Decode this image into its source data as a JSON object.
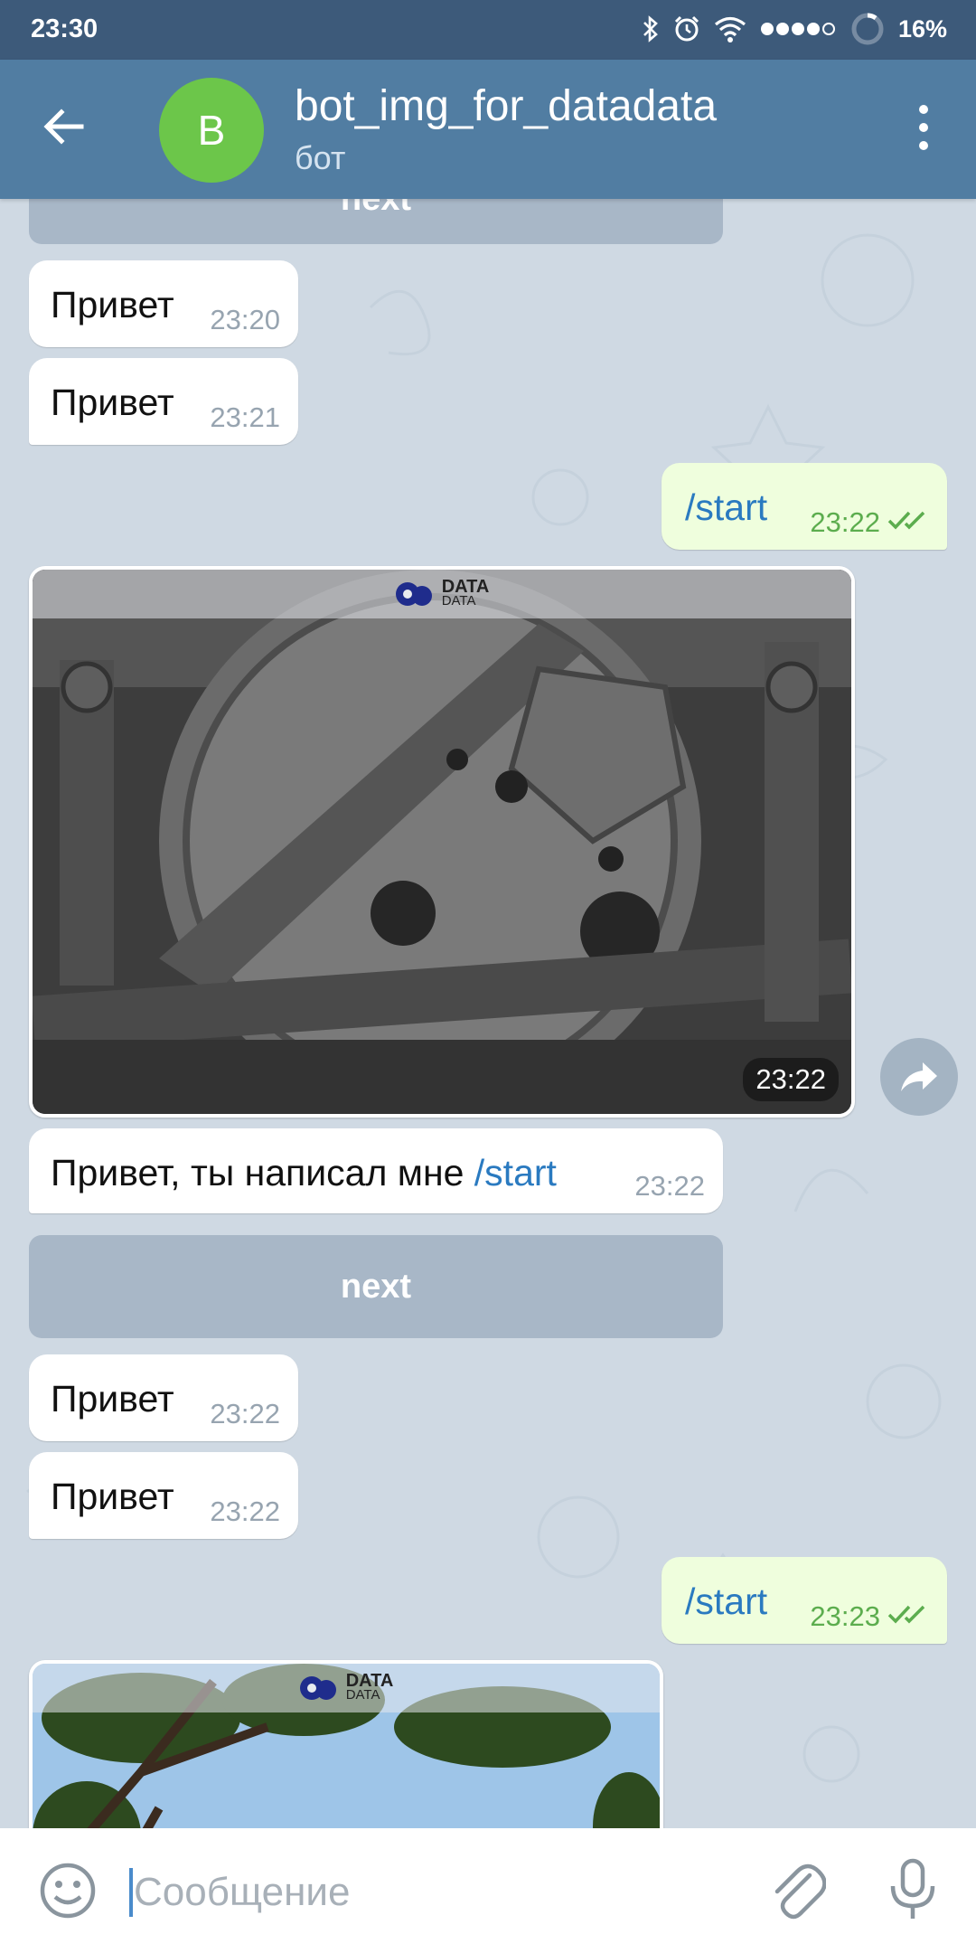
{
  "status_bar": {
    "time": "23:30",
    "battery": "16%"
  },
  "header": {
    "avatar_letter": "B",
    "title": "bot_img_for_datadata",
    "subtitle": "бот"
  },
  "messages": {
    "next_top": "next",
    "m1": {
      "text": "Привет",
      "time": "23:20"
    },
    "m2": {
      "text": "Привет",
      "time": "23:21"
    },
    "m3": {
      "text": "/start",
      "time": "23:22"
    },
    "photo1": {
      "time": "23:22",
      "watermark_line1": "DATA",
      "watermark_line2": "DATA"
    },
    "m4": {
      "text_prefix": "Привет, ты написал мне ",
      "text_link": "/start",
      "time": "23:22"
    },
    "next_button": "next",
    "m5": {
      "text": "Привет",
      "time": "23:22"
    },
    "m6": {
      "text": "Привет",
      "time": "23:22"
    },
    "m7": {
      "text": "/start",
      "time": "23:23"
    },
    "photo2": {
      "watermark_line1": "DATA",
      "watermark_line2": "DATA"
    }
  },
  "input": {
    "placeholder": "Сообщение"
  },
  "colors": {
    "header": "#517da2",
    "status_bar": "#3d5a7a",
    "outgoing": "#effedd",
    "link": "#2a7ac0",
    "avatar": "#6cc64a"
  },
  "icons": [
    "back-arrow-icon",
    "menu-dots-icon",
    "read-checks-icon",
    "share-icon",
    "emoji-icon",
    "attach-icon",
    "mic-icon",
    "bluetooth-icon",
    "alarm-icon",
    "wifi-icon",
    "signal-icon",
    "battery-icon"
  ]
}
